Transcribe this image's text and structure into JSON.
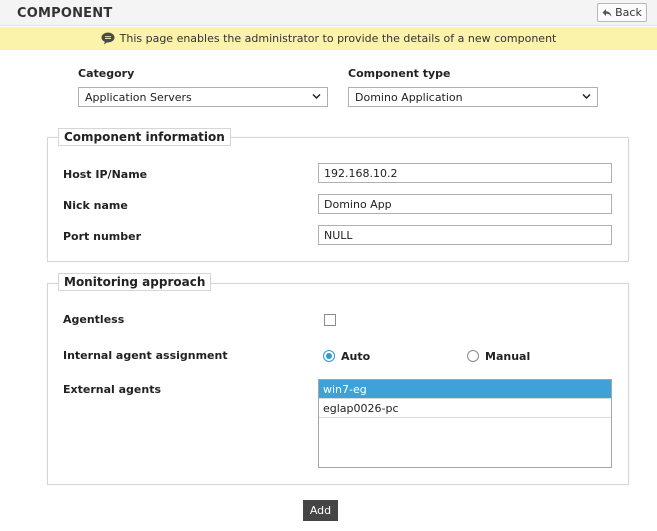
{
  "header": {
    "title": "COMPONENT",
    "back_label": "Back"
  },
  "info_bar": {
    "text": "This page enables the administrator to provide the details of a new component",
    "background": "#fbf3a9"
  },
  "category": {
    "label": "Category",
    "value": "Application Servers"
  },
  "component_type": {
    "label": "Component type",
    "value": "Domino Application"
  },
  "component_info": {
    "legend": "Component information",
    "host_label": "Host IP/Name",
    "host_value": "192.168.10.2",
    "nick_label": "Nick name",
    "nick_value": "Domino App",
    "port_label": "Port number",
    "port_value": "NULL"
  },
  "monitoring": {
    "legend": "Monitoring approach",
    "agentless_label": "Agentless",
    "agentless_checked": false,
    "internal_label": "Internal agent assignment",
    "option_auto": "Auto",
    "option_manual": "Manual",
    "selected_option": "Auto",
    "external_label": "External agents",
    "external_agents": [
      "win7-eg",
      "eglap0026-pc"
    ],
    "selected_agent": "win7-eg",
    "accent_color": "#3ea2d8"
  },
  "actions": {
    "add_label": "Add"
  }
}
